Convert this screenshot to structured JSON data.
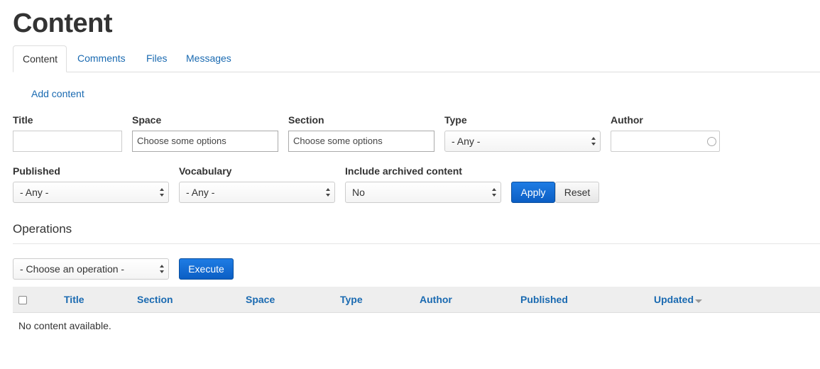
{
  "page": {
    "title": "Content"
  },
  "tabs": [
    {
      "label": "Content",
      "active": true
    },
    {
      "label": "Comments",
      "active": false
    },
    {
      "label": "Files",
      "active": false
    },
    {
      "label": "Messages",
      "active": false
    }
  ],
  "actions": {
    "add_content": "Add content"
  },
  "filters": {
    "title": {
      "label": "Title",
      "value": ""
    },
    "space": {
      "label": "Space",
      "placeholder": "Choose some options"
    },
    "section": {
      "label": "Section",
      "placeholder": "Choose some options"
    },
    "type": {
      "label": "Type",
      "selected": "- Any -"
    },
    "author": {
      "label": "Author",
      "value": ""
    },
    "published": {
      "label": "Published",
      "selected": "- Any -"
    },
    "vocabulary": {
      "label": "Vocabulary",
      "selected": "- Any -"
    },
    "archived": {
      "label": "Include archived content",
      "selected": "No"
    },
    "apply_label": "Apply",
    "reset_label": "Reset"
  },
  "operations": {
    "heading": "Operations",
    "selected": "- Choose an operation -",
    "execute_label": "Execute"
  },
  "table": {
    "columns": [
      "Title",
      "Section",
      "Space",
      "Type",
      "Author",
      "Published",
      "Updated"
    ],
    "sorted_column": "Updated",
    "empty_message": "No content available."
  },
  "colors": {
    "link": "#1a6ab1",
    "primary_button": "#0b5ec4",
    "table_header_bg": "#eeeeee"
  }
}
